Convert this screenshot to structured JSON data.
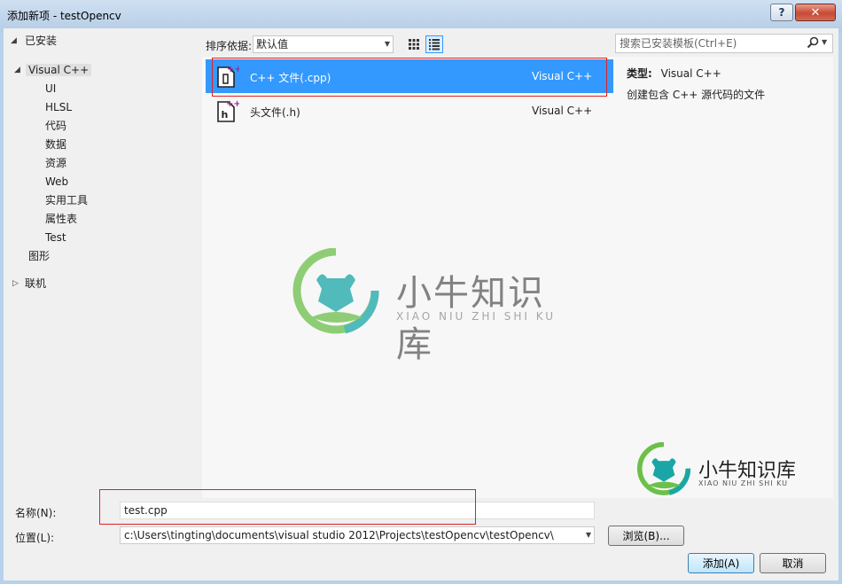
{
  "window": {
    "title": "添加新项 - testOpencv",
    "help_label": "?",
    "close_label": "✕"
  },
  "tree": {
    "installed": "已安装",
    "visual_cpp": "Visual C++",
    "children": [
      "UI",
      "HLSL",
      "代码",
      "数据",
      "资源",
      "Web",
      "实用工具",
      "属性表",
      "Test"
    ],
    "graphics": "图形",
    "online": "联机"
  },
  "toolbar": {
    "sort_label": "排序依据:",
    "sort_value": "默认值"
  },
  "templates": [
    {
      "name": "C++ 文件(.cpp)",
      "type": "Visual C++",
      "selected": true
    },
    {
      "name": "头文件(.h)",
      "type": "Visual C++",
      "selected": false
    }
  ],
  "search": {
    "placeholder": "搜索已安装模板(Ctrl+E)"
  },
  "details": {
    "type_label": "类型:",
    "type_value": "Visual C++",
    "description": "创建包含 C++ 源代码的文件"
  },
  "watermark": {
    "title": "小牛知识库",
    "subtitle": "XIAO NIU ZHI SHI KU"
  },
  "form": {
    "name_label": "名称(N):",
    "name_value": "test.cpp",
    "location_label": "位置(L):",
    "location_value": "c:\\Users\\tingting\\documents\\visual studio 2012\\Projects\\testOpencv\\testOpencv\\",
    "browse_label": "浏览(B)...",
    "add_label": "添加(A)",
    "cancel_label": "取消"
  },
  "colors": {
    "selection": "#3399ff",
    "highlight_box": "#e02020",
    "watermark_teal": "#1aa6a6",
    "watermark_green": "#6cc04a",
    "cpp_icon_accent": "#9b2a8e"
  }
}
